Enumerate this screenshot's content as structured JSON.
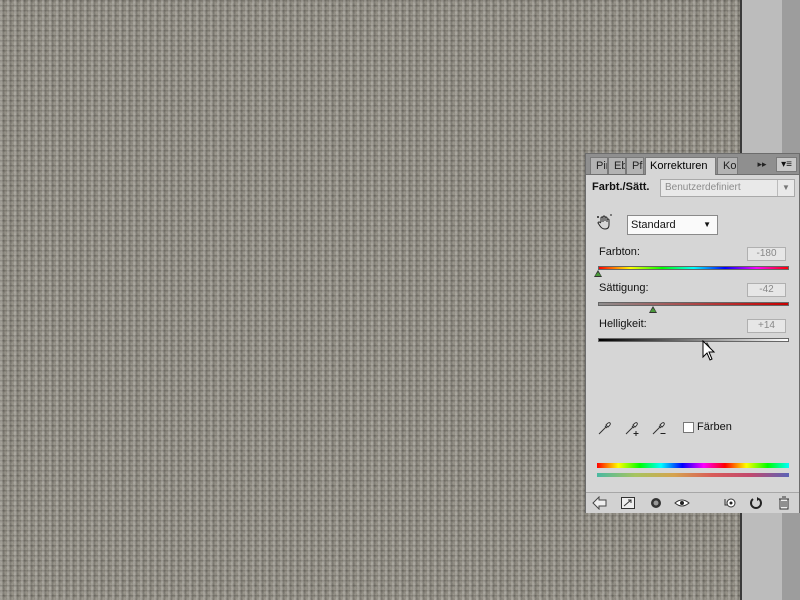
{
  "panel": {
    "tabs": [
      {
        "label": "Pinsel",
        "active": false
      },
      {
        "label": "Ebenen",
        "active": false
      },
      {
        "label": "Pfade",
        "active": false
      },
      {
        "label": "Korrekturen",
        "active": true
      },
      {
        "label": "Ko",
        "active": false
      }
    ],
    "collapse_label": "▸▸",
    "menu_label": "▾≡",
    "adjustment_title": "Farbt./Sätt.",
    "preset": {
      "value": "Benutzerdefiniert"
    },
    "mode": {
      "value": "Standard"
    },
    "sliders": {
      "hue": {
        "label": "Farbton:",
        "value": "-180",
        "fraction": 0.0
      },
      "saturation": {
        "label": "Sättigung:",
        "value": "-42",
        "fraction": 0.29
      },
      "lightness": {
        "label": "Helligkeit:",
        "value": "+14",
        "fraction": 0.57
      }
    },
    "colorize_label": "Färben",
    "colorize_checked": false
  },
  "colors": {
    "canvas": "#8e8a80",
    "panel": "#d6d6d6",
    "tabbar": "#8f8f8f"
  }
}
